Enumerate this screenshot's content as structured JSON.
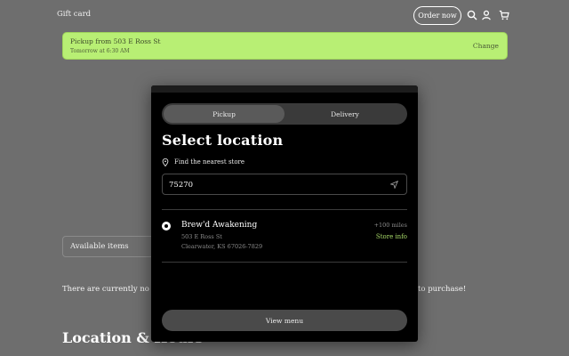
{
  "header": {
    "gift_card": "Gift card",
    "order_now": "Order now",
    "icons": [
      "search-icon",
      "account-icon",
      "cart-icon"
    ]
  },
  "banner": {
    "title": "Pickup from 503 E Ross St",
    "subtitle": "Tomorrow at 6:30 AM",
    "change": "Change",
    "color": "#b8ef74"
  },
  "page": {
    "available_items": "Available items",
    "no_items_left": "There are currently no ite",
    "no_items_right": "to purchase!",
    "location_heading": "Location & Hours"
  },
  "modal": {
    "tabs": [
      {
        "label": "Pickup",
        "active": true
      },
      {
        "label": "Delivery",
        "active": false
      }
    ],
    "title": "Select location",
    "find_nearest": "Find the nearest store",
    "search": {
      "value": "75270",
      "placeholder": ""
    },
    "store": {
      "name": "Brew'd Awakening",
      "address_line1": "503 E Ross St",
      "address_line2": "Clearwater, KS 67026-7829",
      "distance": "+100 miles",
      "info": "Store info",
      "selected": true
    },
    "view_menu": "View menu",
    "accent": "#a9dc6a"
  }
}
